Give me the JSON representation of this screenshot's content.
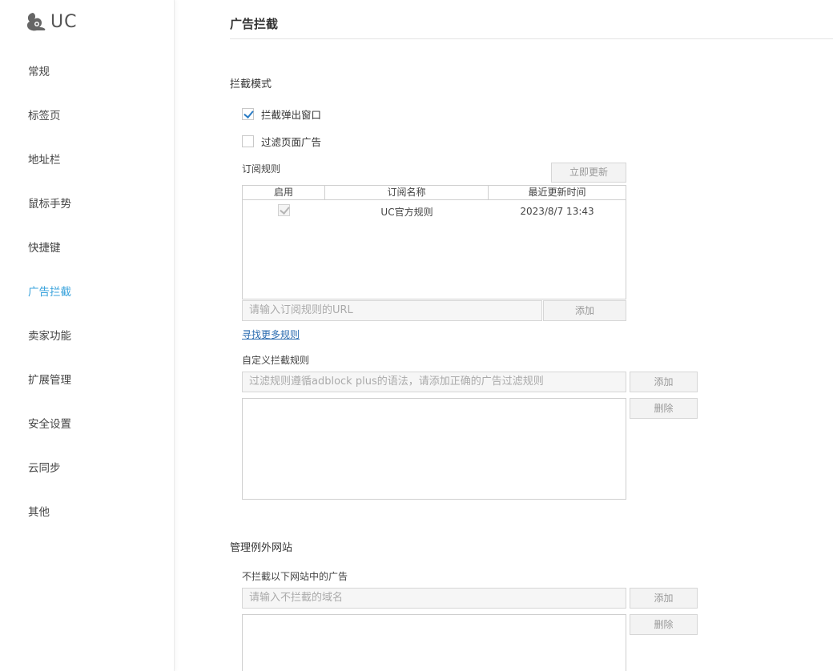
{
  "app": {
    "logo_text": "UC"
  },
  "sidebar": {
    "items": [
      {
        "label": "常规"
      },
      {
        "label": "标签页"
      },
      {
        "label": "地址栏"
      },
      {
        "label": "鼠标手势"
      },
      {
        "label": "快捷键"
      },
      {
        "label": "广告拦截",
        "active": true
      },
      {
        "label": "卖家功能"
      },
      {
        "label": "扩展管理"
      },
      {
        "label": "安全设置"
      },
      {
        "label": "云同步"
      },
      {
        "label": "其他"
      }
    ]
  },
  "main": {
    "title": "广告拦截",
    "block_mode": {
      "title": "拦截模式",
      "popup": {
        "label": "拦截弹出窗口",
        "checked": true
      },
      "page_ads": {
        "label": "过滤页面广告",
        "checked": false
      }
    },
    "subscriptions": {
      "title": "订阅规则",
      "update_button": "立即更新",
      "columns": [
        "启用",
        "订阅名称",
        "最近更新时间"
      ],
      "rows": [
        {
          "enabled": true,
          "name": "UC官方规则",
          "updated": "2023/8/7 13:43"
        }
      ],
      "url_placeholder": "请输入订阅规则的URL",
      "add_button": "添加",
      "more_link": "寻找更多规则"
    },
    "custom_rules": {
      "title": "自定义拦截规则",
      "placeholder": "过滤规则遵循adblock plus的语法，请添加正确的广告过滤规则",
      "add_button": "添加",
      "delete_button": "删除"
    },
    "exceptions": {
      "title": "管理例外网站",
      "subtitle": "不拦截以下网站中的广告",
      "placeholder": "请输入不拦截的域名",
      "add_button": "添加",
      "delete_button": "删除"
    }
  },
  "colors": {
    "accent": "#3aa3dc",
    "link": "#2b6cb0",
    "check": "#2b7cc4"
  }
}
